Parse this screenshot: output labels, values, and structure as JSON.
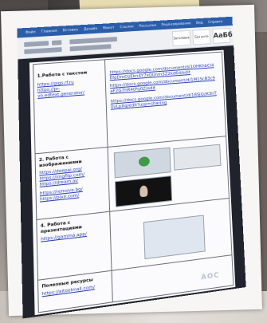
{
  "word_ribbon": {
    "tabs": [
      "Файл",
      "Главная",
      "Вставка",
      "Дизайн",
      "Макет",
      "Ссылки",
      "Рассылки",
      "Рецензирование",
      "Вид",
      "Справка"
    ],
    "styles": [
      "Заголовок",
      "Без инте",
      "АаБб"
    ]
  },
  "monitor_brand": "AOC",
  "table_rows": [
    {
      "left_heading": "1.Работа с текстом",
      "left_links": [
        "https://gigs.rf.ru",
        "https://pr-vo.edtext.generator/"
      ],
      "right_links": [
        "https://docs.google.com/document/d/1OHKhbCl4EfpDmOzEkn4Y7sQUnm3Z2kd6d/edit",
        "https://docs.google.com/document/d/1M1ScB3c9aF2G7hR4tPq0Z/edit",
        "https://docs.google.com/document/d/18SjQzK3nT0vLpXq/edit?usp=sharing"
      ]
    },
    {
      "left_heading": "2. Работа с изображениями",
      "left_links": [
        "https://deepai.org/",
        "https://imgflip.com/",
        "https://dream.ai/",
        "https://remove.bg/",
        "https://pixlr.com/"
      ]
    },
    {
      "left_heading": "4. Работа с презентациями",
      "left_links": [
        "https://gamma.app/"
      ]
    },
    {
      "left_heading": "Полезные ресурсы",
      "left_links": [
        "https://aitoolmall.com/"
      ]
    }
  ]
}
